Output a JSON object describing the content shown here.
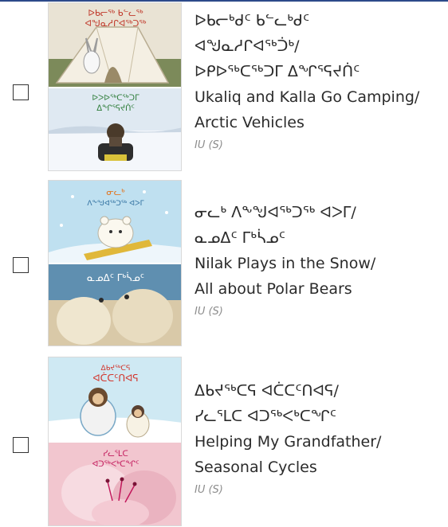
{
  "books": [
    {
      "cover": {
        "top_lines": [
          "ᐅᑲᓕᖅ ᑲᓪᓚᖅ",
          "ᐊᖑᓇᓱᒋᐊᖅᑐᖅ"
        ],
        "bottom_lines": [
          "ᐅᐳᐅᖅᑕᖅᑐᒥ",
          "ᐃᖏᕐᕋᔪᑏᑦ"
        ]
      },
      "title_lines": [
        "ᐅᑲᓕᒃᑯᑦ ᑲᓪᓚᒃᑯᑦ",
        "ᐊᖑᓇᓱᒋᐊᖅᑑᒃ/",
        "ᐅᑭᐅᖅᑕᖅᑐᒥ ᐃᖏᕐᕋᔪᑏᑦ",
        "Ukaliq and Kalla Go Camping/",
        "Arctic Vehicles"
      ],
      "language": "IU (S)"
    },
    {
      "cover": {
        "top_lines": [
          "ᓂᓚᒃ",
          "ᐱᖕᖑᐊᖅᑐᖅ ᐊᐳᒥ"
        ],
        "bottom_lines": [
          "ᓇᓄᐃᑦ ᒥᒃᓵᓄᑦ"
        ]
      },
      "title_lines": [
        "ᓂᓚᒃ ᐱᖕᖑᐊᖅᑐᖅ ᐊᐳᒥ/",
        "ᓇᓄᐃᑦ ᒥᒃᓵᓄᑦ",
        "Nilak Plays in the Snow/",
        "All about Polar Bears"
      ],
      "language": "IU (S)"
    },
    {
      "cover": {
        "top_lines": [
          "ᐃᑲᔪᖅᑕᕋ",
          "ᐊᑖᑕᑦᑎᐊᕋ"
        ],
        "bottom_lines": [
          "ᓯᓚᕐᒪᑕ",
          "ᐊᑐᖅᐸᒃᑕᖏᑦ"
        ]
      },
      "title_lines": [
        "ᐃᑲᔪᖅᑕᕋ ᐊᑖᑕᑦᑎᐊᕋ/",
        "ᓯᓚᕐᒪᑕ ᐊᑐᖅᐸᒃᑕᖏᑦ",
        "Helping My Grandfather/",
        "Seasonal Cycles"
      ],
      "language": "IU (S)"
    }
  ]
}
